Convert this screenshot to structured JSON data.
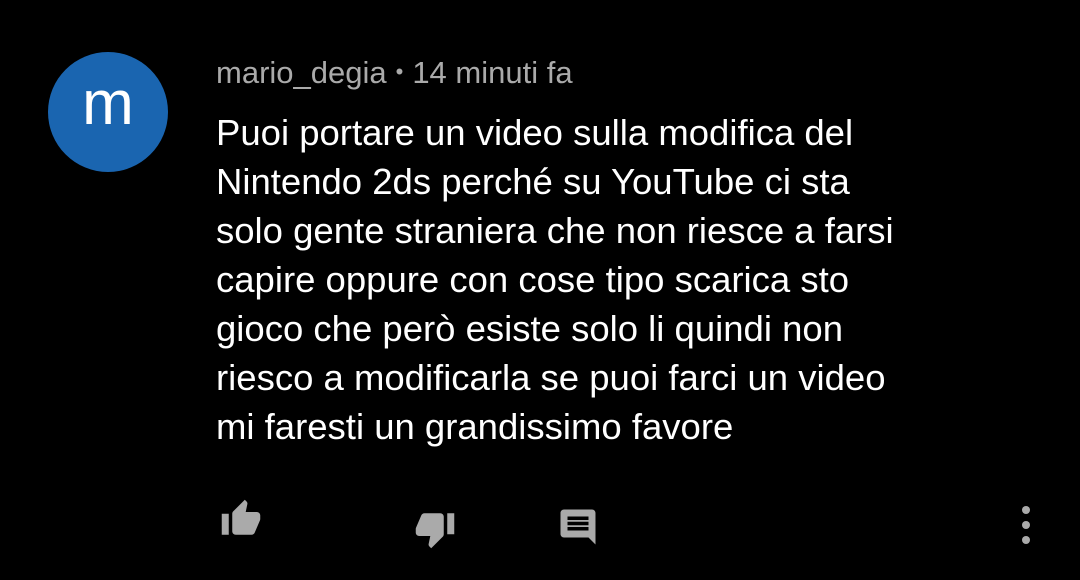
{
  "colors": {
    "background": "#000000",
    "avatar": "#1a65b0",
    "meta_text": "#aaaaaa",
    "comment_text": "#ffffff",
    "icon": "#aaaaaa"
  },
  "comment": {
    "avatar_letter": "m",
    "author": "mario_degia",
    "separator": "•",
    "time": "14 minuti fa",
    "lines": [
      "Puoi portare un video sulla modifica del",
      "Nintendo 2ds perché su YouTube ci sta",
      "solo gente straniera che non riesce a farsi",
      "capire oppure con cose tipo scarica sto",
      "gioco che però esiste solo li quindi non",
      "riesco a modificarla se puoi farci un video",
      "mi faresti un grandissimo favore"
    ]
  },
  "actions": {
    "like_icon": "thumb-up-icon",
    "dislike_icon": "thumb-down-icon",
    "reply_icon": "comment-icon",
    "more_icon": "more-vert-icon"
  }
}
